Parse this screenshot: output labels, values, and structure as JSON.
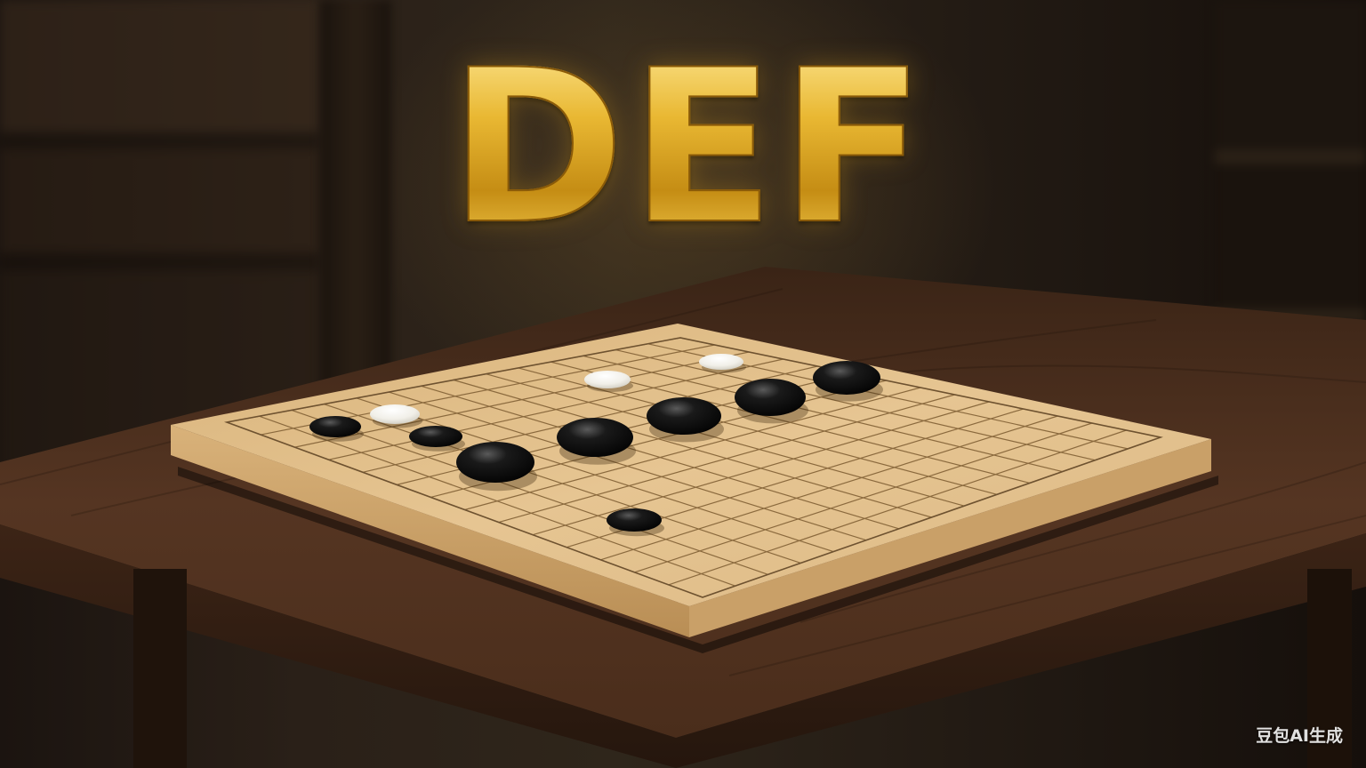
{
  "title": "DEF",
  "watermark": "豆包AI生成",
  "board": {
    "stones": [
      {
        "color": "black",
        "name": "black-stone-1"
      },
      {
        "color": "white",
        "name": "white-stone-1"
      },
      {
        "color": "black",
        "name": "black-stone-2"
      },
      {
        "color": "black",
        "name": "black-stone-3"
      },
      {
        "color": "white",
        "name": "white-stone-2"
      },
      {
        "color": "black",
        "name": "black-stone-4"
      },
      {
        "color": "black",
        "name": "black-stone-5"
      },
      {
        "color": "white",
        "name": "white-stone-3"
      },
      {
        "color": "black",
        "name": "black-stone-6"
      },
      {
        "color": "black",
        "name": "black-stone-7"
      },
      {
        "color": "black",
        "name": "black-stone-8"
      }
    ]
  },
  "colors": {
    "gold": "#e3b028",
    "board": "#e3c08c",
    "table": "#4a2e1c"
  }
}
